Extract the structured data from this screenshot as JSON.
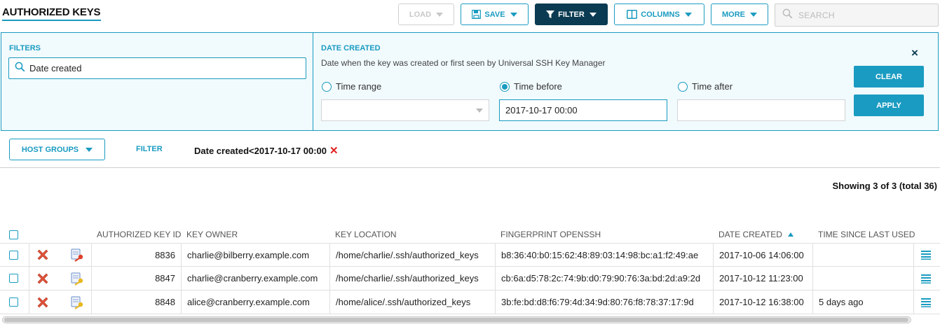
{
  "page": {
    "title": "AUTHORIZED KEYS"
  },
  "toolbar": {
    "load_label": "LOAD",
    "save_label": "SAVE",
    "filter_label": "FILTER",
    "columns_label": "COLUMNS",
    "more_label": "MORE",
    "search_placeholder": "SEARCH"
  },
  "filter_panel": {
    "filters_label": "FILTERS",
    "filters_value": "Date created",
    "date_title": "DATE CREATED",
    "date_description": "Date when the key was created or first seen by Universal SSH Key Manager",
    "options": [
      {
        "label": "Time range",
        "checked": false
      },
      {
        "label": "Time before",
        "checked": true
      },
      {
        "label": "Time after",
        "checked": false
      }
    ],
    "time_range_value": "",
    "time_before_value": "2017-10-17 00:00",
    "time_after_value": "",
    "close_glyph": "×",
    "clear_label": "CLEAR",
    "apply_label": "APPLY"
  },
  "filter_bar": {
    "host_groups_label": "HOST GROUPS",
    "filter_label": "FILTER",
    "active_filter": "Date created<2017-10-17 00:00",
    "remove_glyph": "✕"
  },
  "showing_text": "Showing 3 of 3 (total 36)",
  "table": {
    "columns": {
      "id": "AUTHORIZED KEY ID",
      "owner": "KEY OWNER",
      "location": "KEY LOCATION",
      "fingerprint": "FINGERPRINT OPENSSH",
      "date_created": "DATE CREATED",
      "last_used": "TIME SINCE LAST USED"
    },
    "rows": [
      {
        "id": "8836",
        "owner": "charlie@bilberry.example.com",
        "location": "/home/charlie/.ssh/authorized_keys",
        "fingerprint": "b8:36:40:b0:15:62:48:89:03:14:98:bc:a1:f2:49:ae",
        "date_created": "2017-10-06 14:06:00",
        "last_used": "",
        "key_icon": "key-red-icon"
      },
      {
        "id": "8847",
        "owner": "charlie@cranberry.example.com",
        "location": "/home/charlie/.ssh/authorized_keys",
        "fingerprint": "cb:6a:d5:78:2c:74:9b:d0:79:90:76:3a:bd:2d:a9:2d",
        "date_created": "2017-10-12 11:23:00",
        "last_used": "",
        "key_icon": "key-yellow-icon"
      },
      {
        "id": "8848",
        "owner": "alice@cranberry.example.com",
        "location": "/home/alice/.ssh/authorized_keys",
        "fingerprint": "3b:fe:bd:d8:f6:79:4d:34:9d:80:76:f8:78:37:17:9d",
        "date_created": "2017-10-12 16:38:00",
        "last_used": "5 days ago",
        "key_icon": "key-yellow-icon"
      }
    ]
  },
  "colors": {
    "accent": "#1a9bc1",
    "dark": "#0a3b52",
    "danger": "#e02020"
  }
}
